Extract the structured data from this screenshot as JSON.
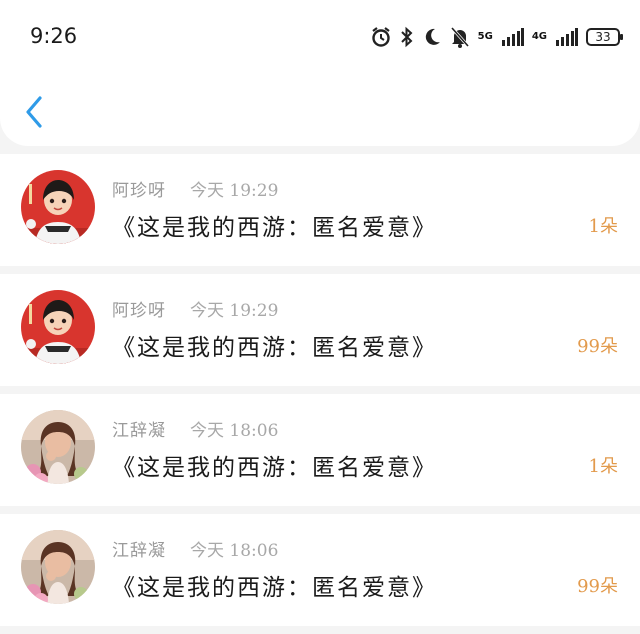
{
  "status": {
    "time": "9:26",
    "net5g": "5G",
    "net4g": "4G",
    "battery": "33"
  },
  "header": {
    "back_icon": "chevron-left-icon"
  },
  "accent": "#e29a4c",
  "gifts": [
    {
      "user": "阿珍呀",
      "day": "今天",
      "clock": "19:29",
      "title": "《这是我的西游：匿名爱意》",
      "count": "1朵",
      "avatar": "cartoon-girl-red"
    },
    {
      "user": "阿珍呀",
      "day": "今天",
      "clock": "19:29",
      "title": "《这是我的西游：匿名爱意》",
      "count": "99朵",
      "avatar": "cartoon-girl-red"
    },
    {
      "user": "江辞凝",
      "day": "今天",
      "clock": "18:06",
      "title": "《这是我的西游：匿名爱意》",
      "count": "1朵",
      "avatar": "photo-woman-flowers"
    },
    {
      "user": "江辞凝",
      "day": "今天",
      "clock": "18:06",
      "title": "《这是我的西游：匿名爱意》",
      "count": "99朵",
      "avatar": "photo-woman-flowers"
    }
  ]
}
